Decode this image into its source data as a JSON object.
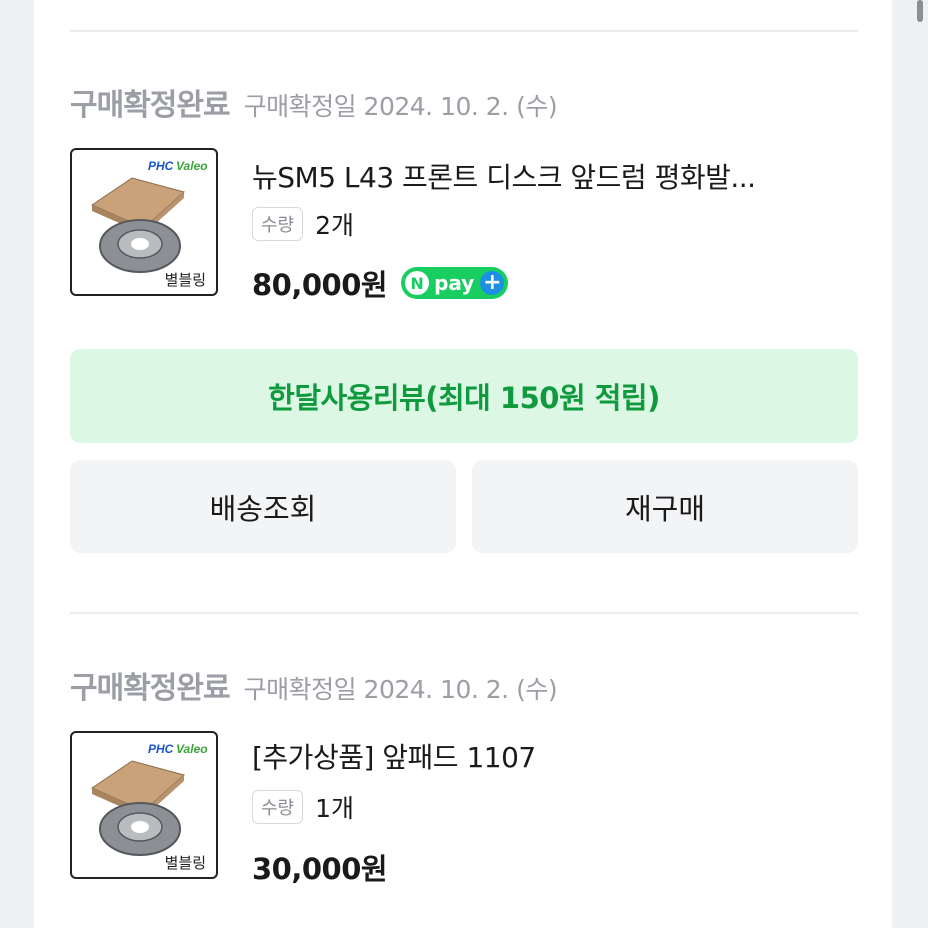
{
  "orders": [
    {
      "status": "구매확정완료",
      "date_text": "구매확정일 2024. 10. 2. (수)",
      "thumbnail": {
        "brand": "PHC Valeo",
        "label": "별블링"
      },
      "product_name": "뉴SM5 L43 프론트 디스크 앞드럼 평화발...",
      "qty_tag": "수량",
      "qty_value": "2개",
      "price": "80,000원",
      "npay": {
        "n": "N",
        "text": "pay",
        "plus": "+"
      }
    },
    {
      "status": "구매확정완료",
      "date_text": "구매확정일 2024. 10. 2. (수)",
      "thumbnail": {
        "brand": "PHC Valeo",
        "label": "별블링"
      },
      "product_name": "[추가상품] 앞패드 1107",
      "qty_tag": "수량",
      "qty_value": "1개",
      "price": "30,000원"
    }
  ],
  "actions": {
    "review": "한달사용리뷰(최대 150원 적립)",
    "track_delivery": "배송조회",
    "reorder": "재구매"
  },
  "colors": {
    "review_bg": "#ddf7e5",
    "review_text": "#0f9b3d",
    "npay_green": "#19ce60",
    "npay_plus_blue": "#1d8fe5"
  }
}
